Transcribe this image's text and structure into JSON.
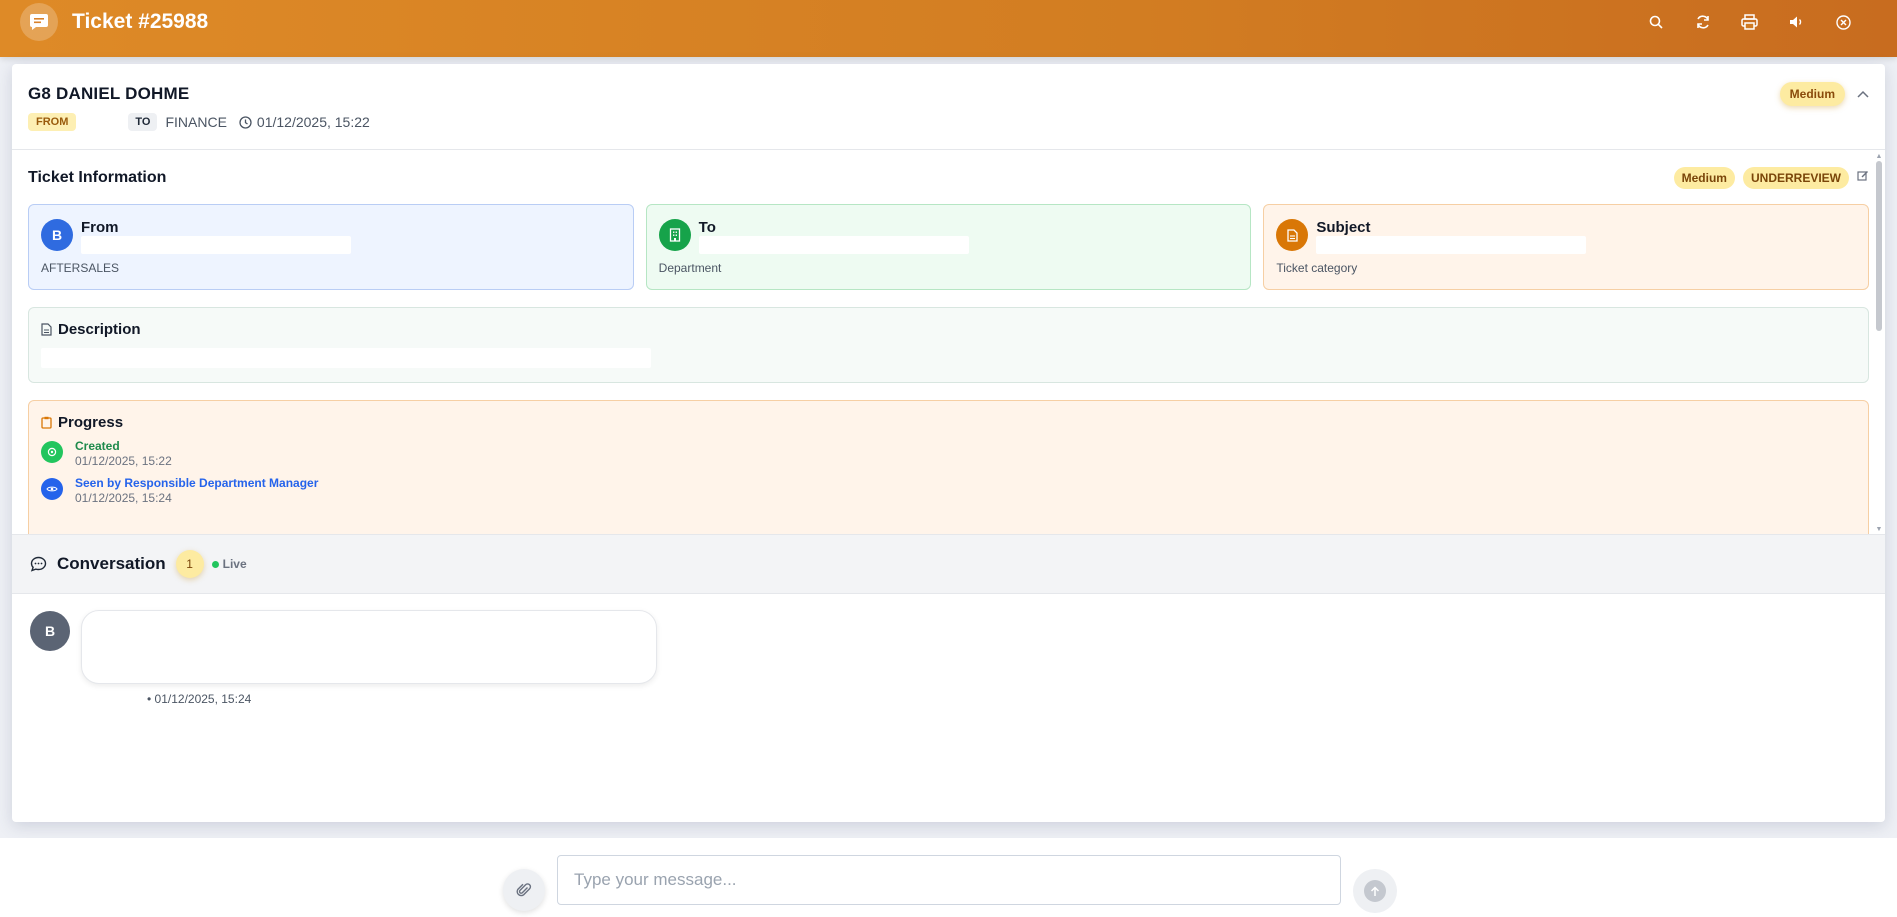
{
  "header": {
    "title": "Ticket #25988",
    "icons": [
      "chat-icon",
      "search-icon",
      "refresh-icon",
      "print-icon",
      "sound-icon",
      "close-icon"
    ]
  },
  "ticket": {
    "name": "G8 DANIEL DOHME",
    "from_label": "FROM",
    "to_label": "TO",
    "to_value": "FINANCE",
    "datetime": "01/12/2025, 15:22",
    "priority": "Medium"
  },
  "info": {
    "title": "Ticket Information",
    "priority": "Medium",
    "status": "UNDERREVIEW",
    "cards": [
      {
        "initial": "B",
        "title": "From",
        "sub": "AFTERSALES",
        "color": "#2f6be0"
      },
      {
        "title": "To",
        "sub": "Department",
        "color": "#16a34a"
      },
      {
        "title": "Subject",
        "sub": "Ticket category",
        "color": "#d97706"
      }
    ]
  },
  "description": {
    "title": "Description"
  },
  "progress": {
    "title": "Progress",
    "steps": [
      {
        "label": "Created",
        "time": "01/12/2025, 15:22",
        "color": "#1f8a4c",
        "dot": "#22c55e"
      },
      {
        "label": "Seen by Responsible Department Manager",
        "time": "01/12/2025, 15:24",
        "color": "#2563eb",
        "dot": "#2563eb"
      }
    ]
  },
  "conversation": {
    "title": "Conversation",
    "count": "1",
    "live": "Live",
    "message": {
      "avatar": "B",
      "meta": "• 01/12/2025, 15:24"
    }
  },
  "composer": {
    "placeholder": "Type your message..."
  },
  "colors": {
    "header_start": "#de8a27",
    "header_end": "#c86c1f",
    "badge_bg": "#fdeba1"
  }
}
